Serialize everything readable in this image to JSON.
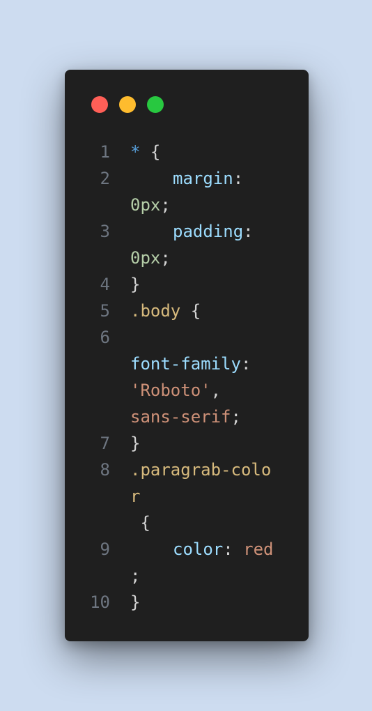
{
  "window": {
    "controls": [
      {
        "name": "close",
        "color": "#ff5f57"
      },
      {
        "name": "minimize",
        "color": "#febc2e"
      },
      {
        "name": "maximize",
        "color": "#28c840"
      }
    ]
  },
  "colors": {
    "background": "#cddcf0",
    "editor": "#1f1f1f",
    "line_number": "#6e7681",
    "selector": "#d7ba7d",
    "universal_selector": "#569cd6",
    "property": "#9cdcfe",
    "number": "#b5cea8",
    "string": "#ce9178",
    "punctuation": "#d4d4d4"
  },
  "code": {
    "line_numbers": [
      "1",
      "2",
      "3",
      "4",
      "5",
      "6",
      "7",
      "8",
      "9",
      "10"
    ],
    "l1": {
      "sel": "*",
      "brace": " {"
    },
    "l2": {
      "prop": "margin",
      "colon": ":",
      "val": "0px",
      "semi": ";"
    },
    "l3": {
      "prop": "padding",
      "colon": ":",
      "val": "0px",
      "semi": ";"
    },
    "l4": {
      "close": "}"
    },
    "l5": {
      "sel": ".body",
      "brace": " {"
    },
    "l6": {
      "prop": "font-family",
      "colon": ":",
      "str": "'Roboto'",
      "comma": ",",
      "val": "sans-serif",
      "semi": ";"
    },
    "l7": {
      "close": "}"
    },
    "l8": {
      "sel_a": ".paragrab-colo",
      "sel_b": "r",
      "brace": " {"
    },
    "l9": {
      "prop": "color",
      "colon": ": ",
      "val": "red",
      "semi": ";"
    },
    "l10": {
      "close": "}"
    }
  }
}
